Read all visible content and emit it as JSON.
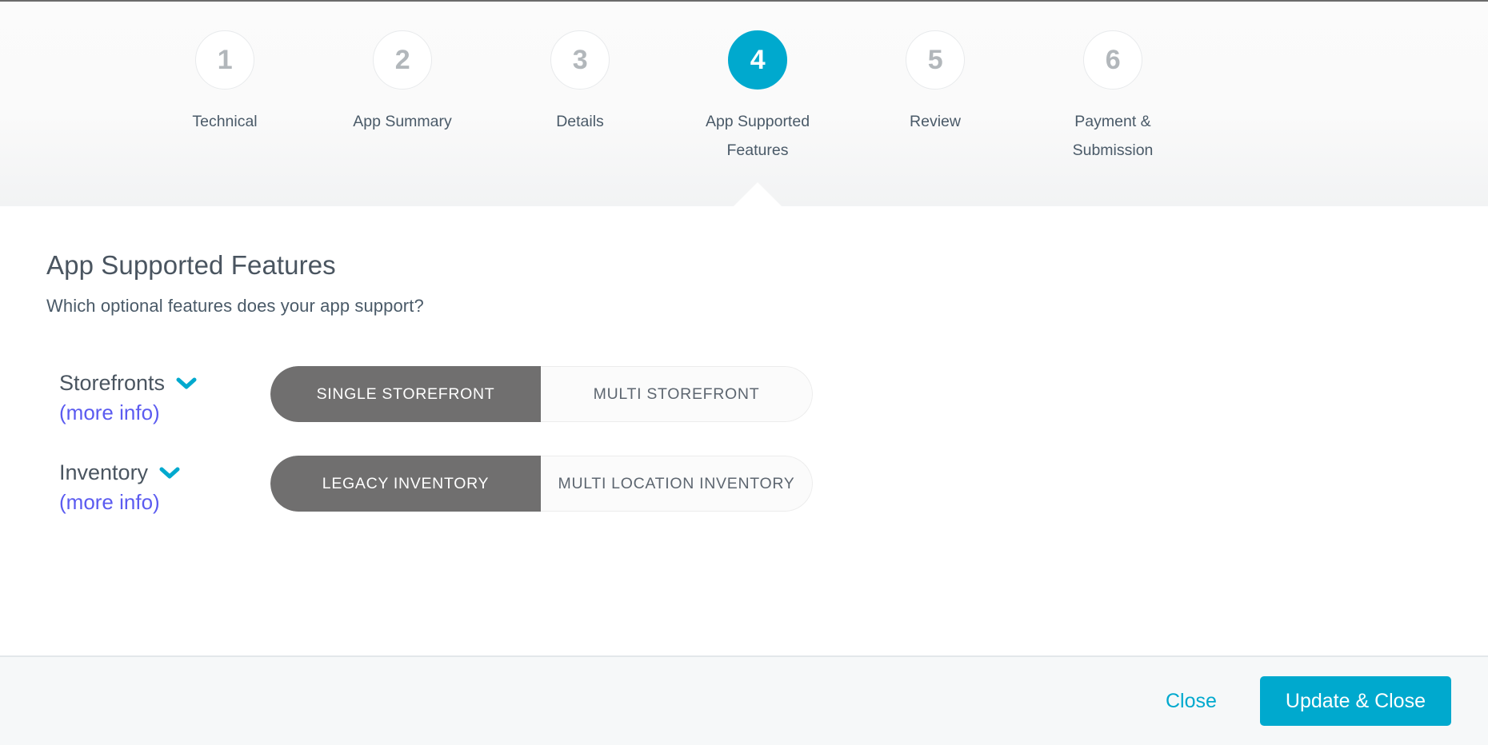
{
  "stepper": {
    "active_step": 4,
    "active_color": "#00a9ce",
    "steps": [
      {
        "number": "1",
        "label": "Technical"
      },
      {
        "number": "2",
        "label": "App Summary"
      },
      {
        "number": "3",
        "label": "Details"
      },
      {
        "number": "4",
        "label": "App Supported Features"
      },
      {
        "number": "5",
        "label": "Review"
      },
      {
        "number": "6",
        "label": "Payment & Submission"
      }
    ]
  },
  "main": {
    "title": "App Supported Features",
    "subtitle": "Which optional features does your app support?",
    "features": [
      {
        "label": "Storefronts",
        "more_info_label": "(more info)",
        "chevron_icon": "chevron-down-icon",
        "options": [
          {
            "label": "SINGLE STOREFRONT",
            "selected": true
          },
          {
            "label": "MULTI STOREFRONT",
            "selected": false
          }
        ]
      },
      {
        "label": "Inventory",
        "more_info_label": "(more info)",
        "chevron_icon": "chevron-down-icon",
        "options": [
          {
            "label": "LEGACY INVENTORY",
            "selected": true
          },
          {
            "label": "MULTI LOCATION INVENTORY",
            "selected": false
          }
        ]
      }
    ]
  },
  "footer": {
    "close_label": "Close",
    "primary_label": "Update & Close"
  },
  "colors": {
    "accent": "#00a9ce",
    "selected_toggle": "#706f6f",
    "link": "#5b5bf0",
    "text": "#4a5560"
  }
}
